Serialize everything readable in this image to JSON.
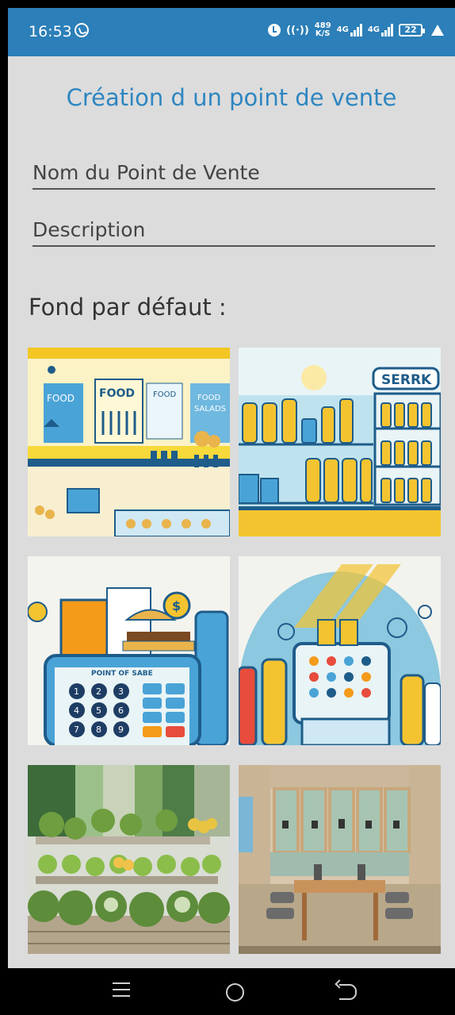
{
  "status_bar": {
    "time": "16:53",
    "speed_value": "489",
    "speed_unit": "K/S",
    "network_1": "4G",
    "network_2": "4G",
    "battery_level": "22",
    "color": "#2c7fb8"
  },
  "page": {
    "title": "Création d un point de vente",
    "accent_color": "#2e86c1"
  },
  "form": {
    "name_placeholder": "Nom du Point de Vente",
    "description_placeholder": "Description"
  },
  "backgrounds": {
    "label": "Fond par défaut :",
    "items": [
      {
        "icon": "food-shop-illustration",
        "label_1": "FOOD",
        "label_2": "FOOD",
        "label_3": "FOOD",
        "label_4": "FOOD",
        "label_5": "SALADS"
      },
      {
        "icon": "drinks-shelf-illustration",
        "label_1": "SERRK"
      },
      {
        "icon": "point-of-sale-terminal-illustration",
        "label_1": "POINT OF SABE",
        "keys": [
          "1",
          "2",
          "3",
          "4",
          "5",
          "6",
          "7",
          "8",
          "9"
        ]
      },
      {
        "icon": "pos-terminal-bottles-illustration"
      },
      {
        "icon": "vegetable-market-photo"
      },
      {
        "icon": "electronics-store-photo"
      }
    ]
  },
  "nav_bar": {
    "icons": [
      "menu-icon",
      "home-icon",
      "back-icon"
    ]
  }
}
